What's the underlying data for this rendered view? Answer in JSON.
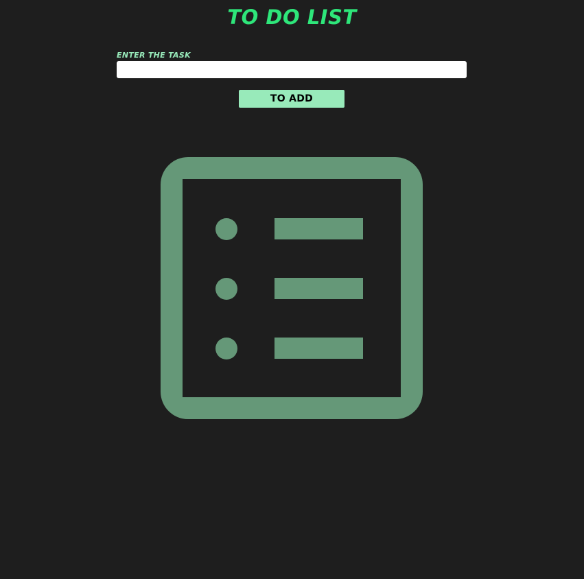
{
  "header": {
    "title": "TO DO LIST"
  },
  "form": {
    "label": "ENTER THE TASK",
    "input_value": "",
    "add_button_label": "TO ADD"
  },
  "empty_state": {
    "icon": "list-icon",
    "icon_color": "#659878"
  },
  "colors": {
    "background": "#1e1e1e",
    "title": "#2ee67a",
    "label": "#98eaba",
    "button": "#98eaba"
  }
}
